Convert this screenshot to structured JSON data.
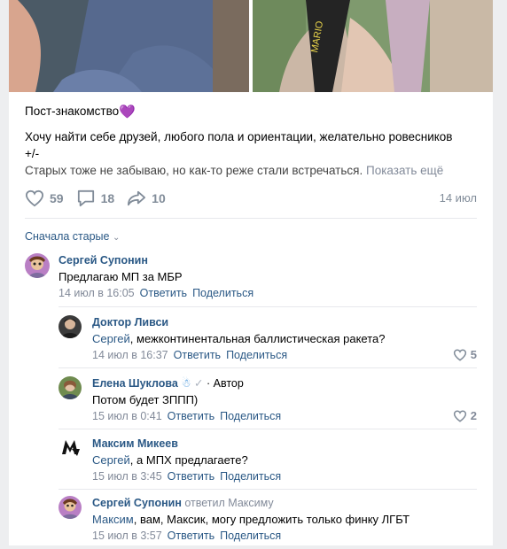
{
  "post": {
    "title": "Пост-знакомство",
    "text_line1": "Хочу найти себе друзей, любого пола и ориентации, желательно ровесников",
    "text_line2": "+/-",
    "text_line3": "Старых тоже не забываю, но как-то реже стали встречаться.",
    "show_more": "Показать ещё",
    "date": "14 июл"
  },
  "actions": {
    "likes": "59",
    "comments": "18",
    "shares": "10"
  },
  "comments_sort": "Сначала старые",
  "comments": [
    {
      "name": "Сергей Супонин",
      "text": "Предлагаю МП за МБР",
      "date": "14 июл в 16:05",
      "reply": "Ответить",
      "share": "Поделиться"
    }
  ],
  "replies": [
    {
      "name": "Доктор Ливси",
      "mention": "Сергей",
      "text": ", межконтинентальная баллистическая ракета?",
      "date": "14 июл в 16:37",
      "reply": "Ответить",
      "share": "Поделиться",
      "likes": "5"
    },
    {
      "name": "Елена Шуклова",
      "author_mark": " · Автор",
      "text": "Потом будет ЗППП)",
      "date": "15 июл в 0:41",
      "reply": "Ответить",
      "share": "Поделиться",
      "likes": "2"
    },
    {
      "name": "Максим Микеев",
      "mention": "Сергей",
      "text": ", а МПХ предлагаете?",
      "date": "15 июл в 3:45",
      "reply": "Ответить",
      "share": "Поделиться"
    },
    {
      "name": "Сергей Супонин",
      "replied_to": " ответил Максиму",
      "mention": "Максим",
      "text": ", вам, Максик, могу предложить только финку ЛГБТ",
      "date": "15 июл в 3:57",
      "reply": "Ответить",
      "share": "Поделиться"
    }
  ],
  "colors": {
    "link": "#2a5885",
    "muted": "#828a99",
    "background": "#edeef0"
  }
}
